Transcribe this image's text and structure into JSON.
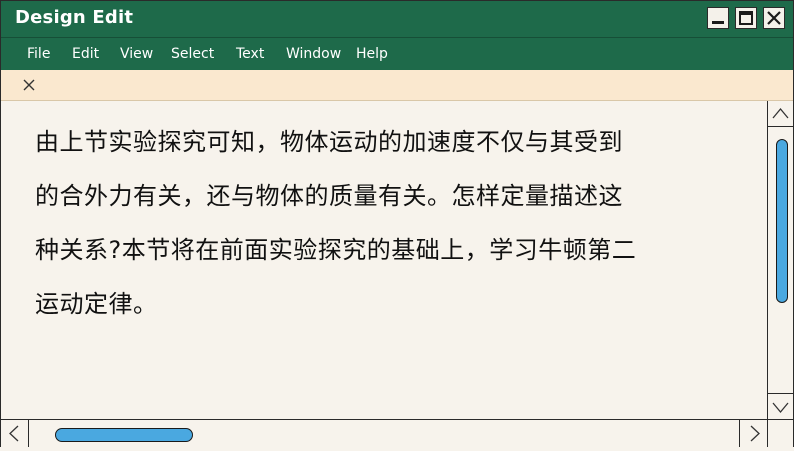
{
  "window": {
    "title": "Design Edit"
  },
  "menu": {
    "items": [
      {
        "label": "File"
      },
      {
        "label": "Edit"
      },
      {
        "label": "View"
      },
      {
        "label": "Select"
      },
      {
        "label": "Text"
      },
      {
        "label": "Window"
      },
      {
        "label": "Help"
      }
    ]
  },
  "tab": {
    "close_icon": "close-icon"
  },
  "document": {
    "text": "由上节实验探究可知，物体运动的加速度不仅与其受到\n的合外力有关，还与物体的质量有关。怎样定量描述这\n种关系?本节将在前面实验探究的基础上，学习牛顿第二\n运动定律。"
  },
  "icons": {
    "minimize": "minimize-icon",
    "maximize": "maximize-icon",
    "close": "close-icon",
    "scroll_up": "chevron-up-icon",
    "scroll_down": "chevron-down-icon",
    "scroll_left": "chevron-left-icon",
    "scroll_right": "chevron-right-icon"
  },
  "colors": {
    "titlebar": "#1e6a4a",
    "tabbar": "#fae8cf",
    "content_bg": "#f7f3ec",
    "scroll_thumb": "#4aa8e0"
  }
}
